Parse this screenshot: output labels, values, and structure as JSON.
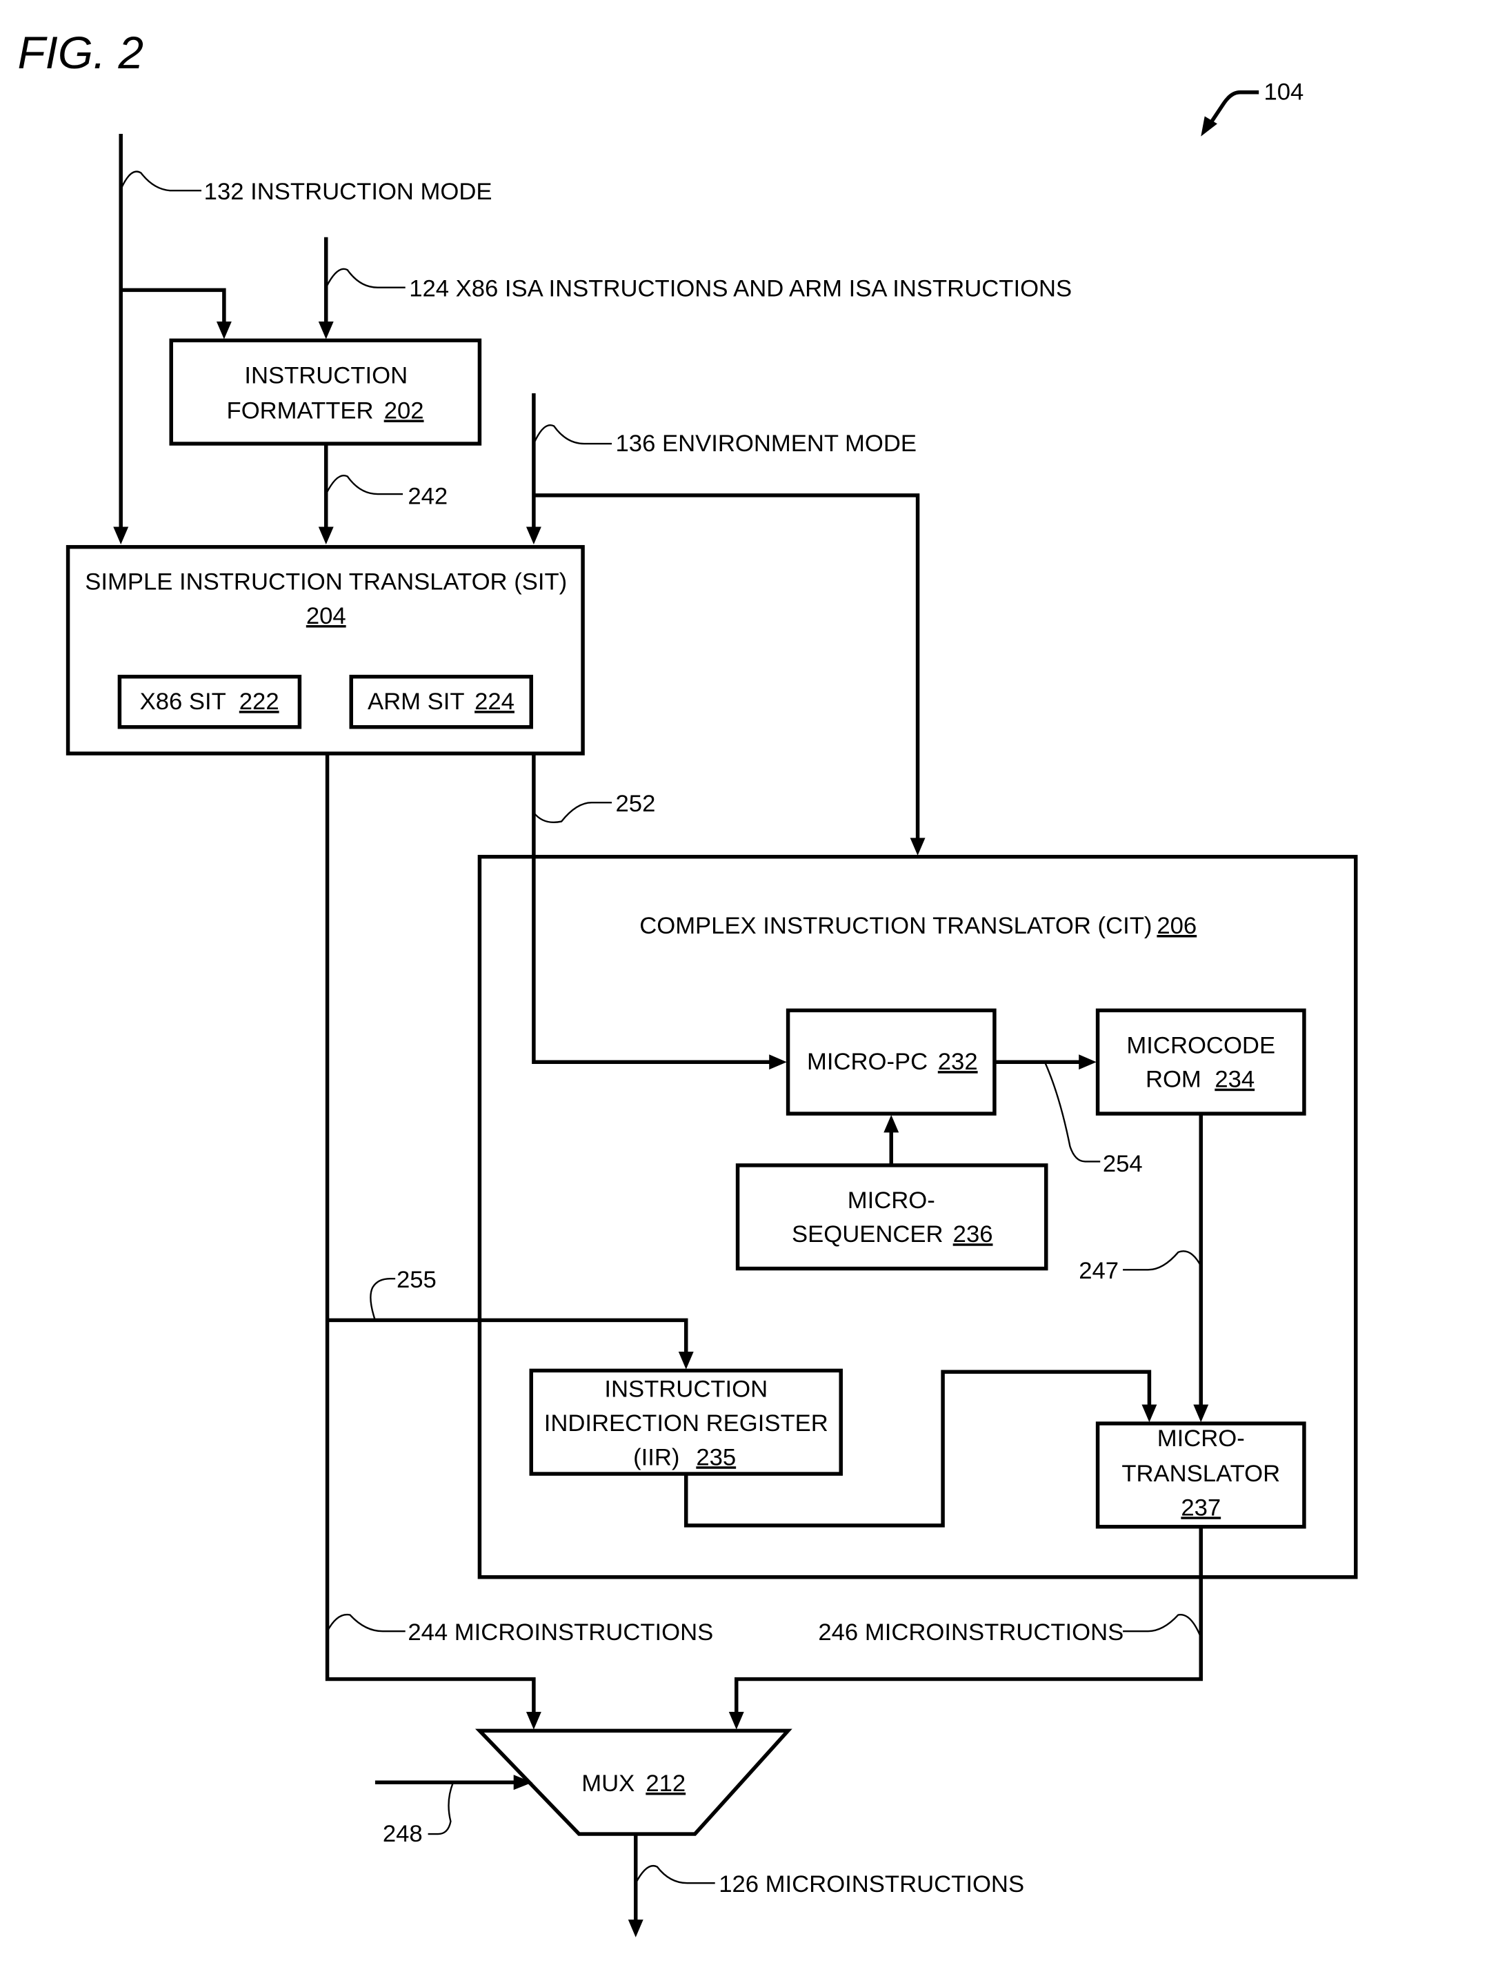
{
  "figure": {
    "title": "FIG. 2",
    "reference": "104"
  },
  "signals": {
    "instruction_mode": "132 INSTRUCTION MODE",
    "isa_instructions": "124 X86 ISA INSTRUCTIONS AND ARM ISA INSTRUCTIONS",
    "environment_mode": "136 ENVIRONMENT MODE",
    "s242": "242",
    "s252": "252",
    "s254": "254",
    "s255": "255",
    "s247": "247",
    "s244": "244 MICROINSTRUCTIONS",
    "s246": "246 MICROINSTRUCTIONS",
    "s248": "248",
    "s126": "126 MICROINSTRUCTIONS"
  },
  "blocks": {
    "formatter": {
      "line1": "INSTRUCTION",
      "line2": "FORMATTER",
      "ref": "202"
    },
    "sit": {
      "line1": "SIMPLE INSTRUCTION TRANSLATOR (SIT)",
      "ref": "204"
    },
    "x86_sit": {
      "label": "X86 SIT",
      "ref": "222"
    },
    "arm_sit": {
      "label": "ARM SIT",
      "ref": "224"
    },
    "cit": {
      "label": "COMPLEX INSTRUCTION TRANSLATOR (CIT)",
      "ref": "206"
    },
    "micro_pc": {
      "label": "MICRO-PC",
      "ref": "232"
    },
    "microcode_rom": {
      "line1": "MICROCODE",
      "line2": "ROM",
      "ref": "234"
    },
    "micro_sequencer": {
      "line1": "MICRO-",
      "line2": "SEQUENCER",
      "ref": "236"
    },
    "iir": {
      "line1": "INSTRUCTION",
      "line2": "INDIRECTION REGISTER",
      "line3": "(IIR)",
      "ref": "235"
    },
    "micro_translator": {
      "line1": "MICRO-",
      "line2": "TRANSLATOR",
      "ref": "237"
    },
    "mux": {
      "label": "MUX",
      "ref": "212"
    }
  }
}
